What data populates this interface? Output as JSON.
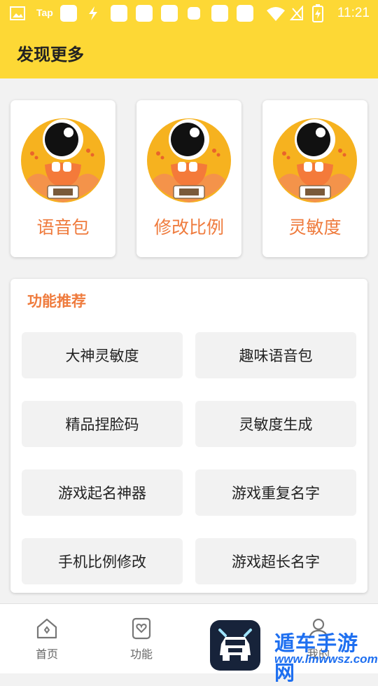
{
  "status_bar": {
    "carrier": "Tap",
    "time": "11:21",
    "icons": [
      "image-icon",
      "notification-icon",
      "lightning-icon",
      "wifi-icon",
      "no-sim-icon",
      "battery-charging-icon"
    ]
  },
  "header": {
    "title": "发现更多"
  },
  "cards": [
    {
      "label": "语音包",
      "icon": "mascot-icon"
    },
    {
      "label": "修改比例",
      "icon": "mascot-icon"
    },
    {
      "label": "灵敏度",
      "icon": "mascot-icon"
    }
  ],
  "panel": {
    "title": "功能推荐",
    "buttons": [
      {
        "label": "大神灵敏度"
      },
      {
        "label": "趣味语音包"
      },
      {
        "label": "精品捏脸码"
      },
      {
        "label": "灵敏度生成"
      },
      {
        "label": "游戏起名神器"
      },
      {
        "label": "游戏重复名字"
      },
      {
        "label": "手机比例修改"
      },
      {
        "label": "游戏超长名字"
      }
    ]
  },
  "bottom_nav": {
    "items": [
      {
        "label": "首页",
        "icon": "home-icon"
      },
      {
        "label": "功能",
        "icon": "heart-card-icon"
      },
      {
        "label": "我的",
        "icon": "user-icon"
      }
    ]
  },
  "watermark": {
    "line1": "遁车手游网",
    "line2": "www.lmwwsz.com",
    "app_icon": "car-app-icon"
  },
  "colors": {
    "accent": "#fdd835",
    "label_orange": "#ef7b3d"
  }
}
